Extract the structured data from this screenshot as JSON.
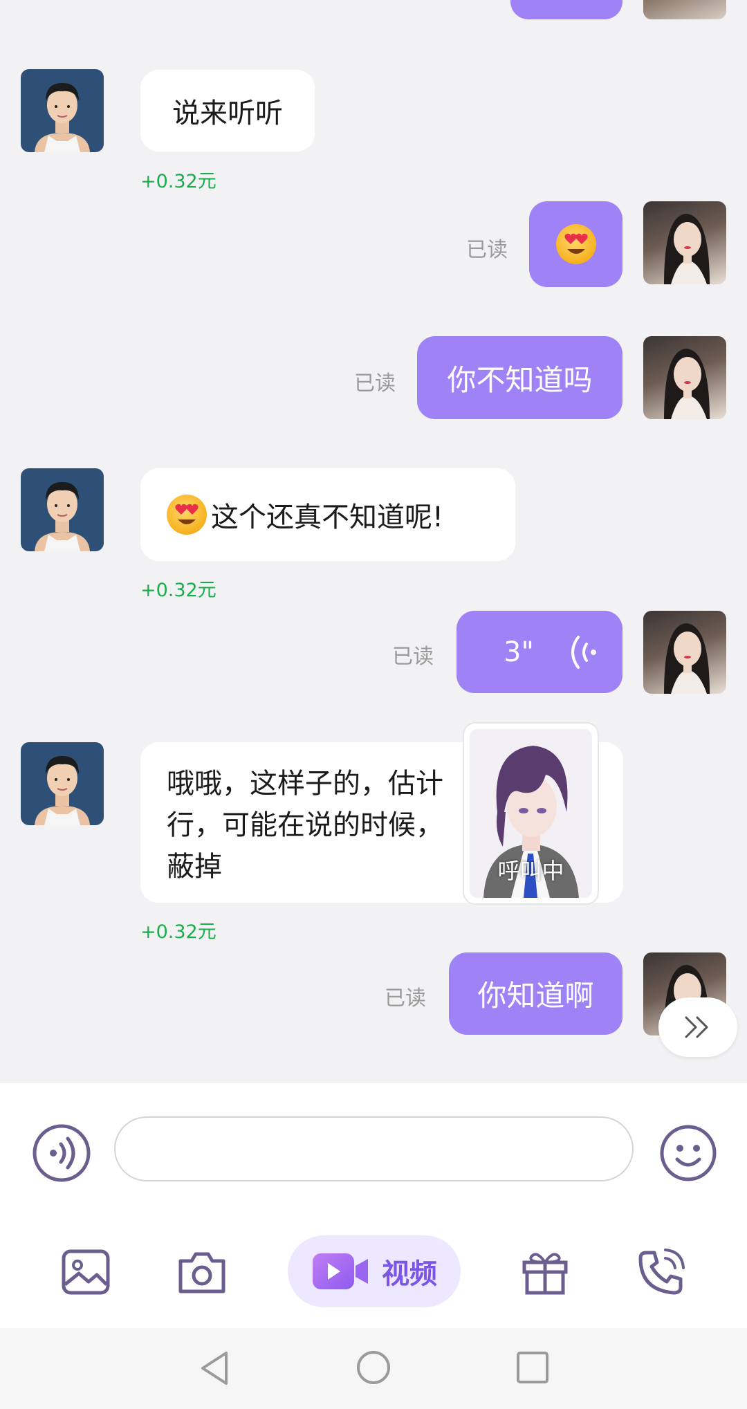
{
  "messages": [
    {
      "id": "m1",
      "side": "in",
      "text": "说来听听",
      "earning": "+0.32元"
    },
    {
      "id": "m2",
      "side": "out",
      "content": "emoji",
      "emoji_name": "heart-eyes",
      "status": "已读"
    },
    {
      "id": "m3",
      "side": "out",
      "text": "你不知道吗",
      "status": "已读"
    },
    {
      "id": "m4",
      "side": "in",
      "text": "这个还真不知道呢!",
      "emoji_prefix": "heart-eyes",
      "earning": "+0.32元"
    },
    {
      "id": "m5",
      "side": "out",
      "content": "voice",
      "duration": "3\"",
      "status": "已读"
    },
    {
      "id": "m6",
      "side": "in",
      "lines": [
        "哦哦，这样子的，估计",
        "行，可能在说的时候，",
        "蔽掉"
      ],
      "earning": "+0.32元"
    },
    {
      "id": "m7",
      "side": "out",
      "text": "你知道啊",
      "status": "已读"
    }
  ],
  "call_overlay": {
    "status": "呼叫中"
  },
  "composer": {
    "input_value": "",
    "placeholder": ""
  },
  "toolbar": {
    "video_label": "视频"
  },
  "colors": {
    "accent": "#9f82f5",
    "earning": "#1aad4c",
    "icon": "#6a5e8e"
  },
  "icons": [
    "voice-icon",
    "emoji-icon",
    "image-icon",
    "camera-icon",
    "video-icon",
    "gift-icon",
    "phone-icon",
    "fast-forward-icon",
    "back-icon",
    "home-icon",
    "recents-icon"
  ]
}
